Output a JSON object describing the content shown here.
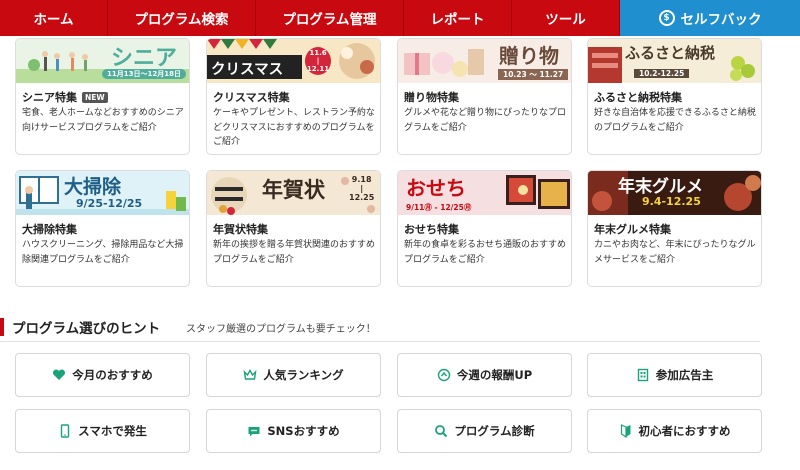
{
  "nav": {
    "items": [
      "ホーム",
      "プログラム検索",
      "プログラム管理",
      "レポート",
      "ツール"
    ],
    "selfback": "セルフバック",
    "selfback_icon_glyph": "$"
  },
  "cards": [
    {
      "title": "シニア特集",
      "badge": "NEW",
      "desc": "宅食、老人ホームなどおすすめのシニア向けサービスプログラムをご紹介",
      "banner_text": "シニア",
      "banner_date": "11月13日～12月18日"
    },
    {
      "title": "クリスマス特集",
      "desc": "ケーキやプレゼント、レストラン予約などクリスマスにおすすめのプログラムをご紹介",
      "banner_text": "クリスマス",
      "banner_date_top": "11.6",
      "banner_date_mid": "|",
      "banner_date_bot": "12.11"
    },
    {
      "title": "贈り物特集",
      "desc": "グルメや花など贈り物にぴったりなプログラムをご紹介",
      "banner_text": "贈り物",
      "banner_date": "10.23 ～ 11.27"
    },
    {
      "title": "ふるさと納税特集",
      "desc": "好きな自治体を応援できるふるさと納税のプログラムをご紹介",
      "banner_text": "ふるさと納税",
      "banner_date": "10.2-12.25"
    },
    {
      "title": "大掃除特集",
      "desc": "ハウスクリーニング、掃除用品など大掃除関連プログラムをご紹介",
      "banner_text": "大掃除",
      "banner_date": "9/25-12/25"
    },
    {
      "title": "年賀状特集",
      "desc": "新年の挨拶を贈る年賀状関連のおすすめプログラムをご紹介",
      "banner_text": "年賀状",
      "banner_date_top": "9.18",
      "banner_date_mid": "|",
      "banner_date_bot": "12.25"
    },
    {
      "title": "おせち特集",
      "desc": "新年の食卓を彩るおせち通販のおすすめプログラムをご紹介",
      "banner_text": "おせち",
      "banner_date": "9/11㊊ - 12/25㊊"
    },
    {
      "title": "年末グルメ特集",
      "desc": "カニやお肉など、年末にぴったりなグルメサービスをご紹介",
      "banner_text": "年末グルメ",
      "banner_date": "9.4-12.25"
    }
  ],
  "section": {
    "title": "プログラム選びのヒント",
    "subtitle": "スタッフ厳選のプログラムも要チェック！"
  },
  "hints": [
    {
      "label": "今月のおすすめ",
      "icon": "heart-icon"
    },
    {
      "label": "人気ランキング",
      "icon": "crown-icon"
    },
    {
      "label": "今週の報酬UP",
      "icon": "coin-up-icon"
    },
    {
      "label": "参加広告主",
      "icon": "building-icon"
    },
    {
      "label": "スマホで発生",
      "icon": "smartphone-icon"
    },
    {
      "label": "SNSおすすめ",
      "icon": "chat-bubble-icon"
    },
    {
      "label": "プログラム診断",
      "icon": "magnifier-icon"
    },
    {
      "label": "初心者におすすめ",
      "icon": "beginner-leaf-icon"
    }
  ],
  "colors": {
    "brand_red": "#c8090f",
    "self_blue": "#1f8fcf",
    "icon_green": "#1aa37a"
  }
}
